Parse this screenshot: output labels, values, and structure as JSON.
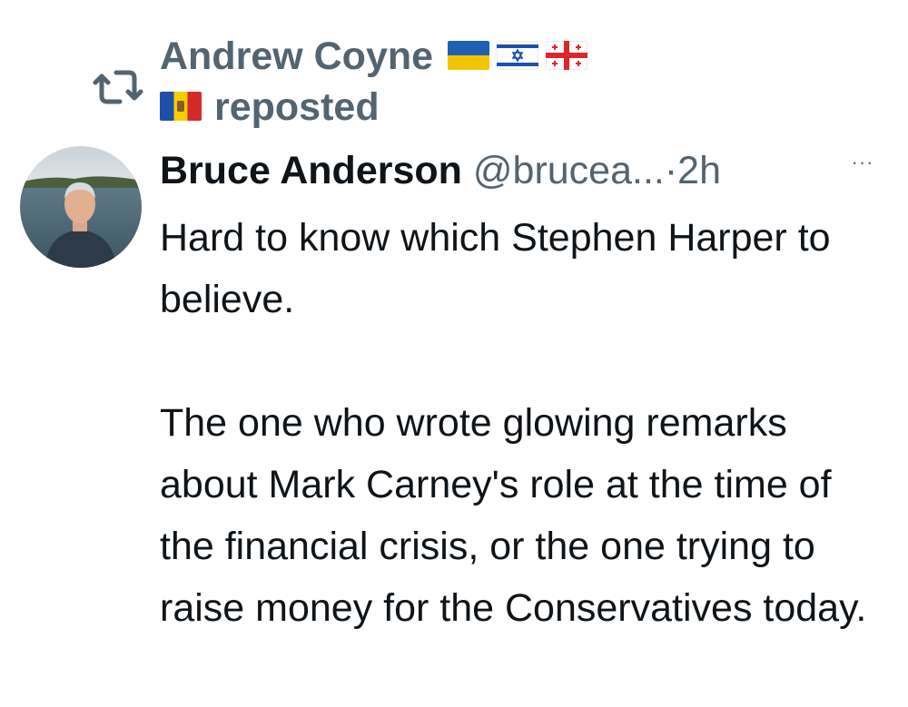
{
  "repost": {
    "reposter_name": "Andrew Coyne",
    "reposted_label": "reposted",
    "icon": "repost-icon",
    "flags": [
      "ukraine-flag",
      "israel-flag",
      "georgia-flag",
      "moldova-flag"
    ]
  },
  "tweet": {
    "author_name": "Bruce Anderson",
    "handle": "@brucea...",
    "separator": "·",
    "time": "2h",
    "more_icon": "more-options-icon",
    "more_label": "···",
    "paragraph1": "Hard to know which Stephen Harper to believe.",
    "paragraph2": "The one who wrote glowing remarks about Mark Carney's role at the time of the financial crisis, or the one trying to raise money for the Conservatives today."
  },
  "colors": {
    "text_primary": "#0f1419",
    "text_secondary": "#536471",
    "background": "#ffffff"
  }
}
